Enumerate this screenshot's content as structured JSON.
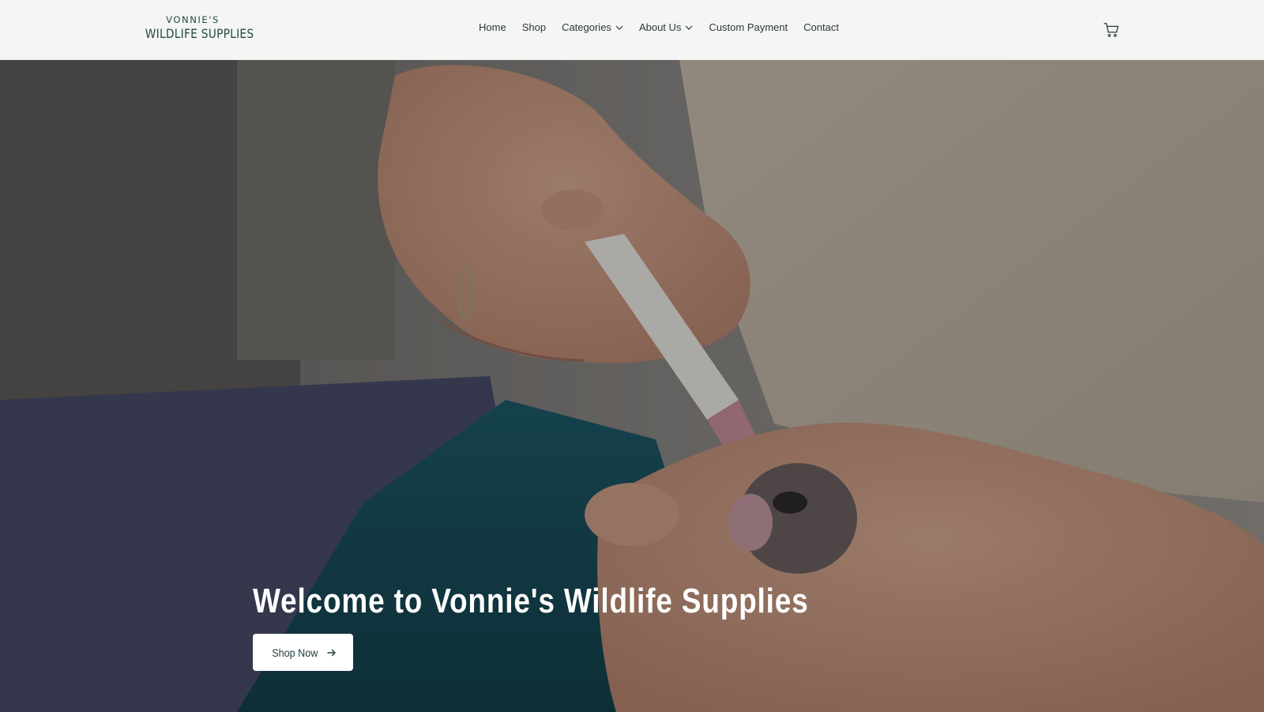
{
  "brand": {
    "line1": "VONNIE'S",
    "line2": "WILDLIFE SUPPLIES",
    "color": "#214848"
  },
  "nav": {
    "items": [
      {
        "label": "Home",
        "has_dropdown": false
      },
      {
        "label": "Shop",
        "has_dropdown": false
      },
      {
        "label": "Categories",
        "has_dropdown": true
      },
      {
        "label": "About Us",
        "has_dropdown": true
      },
      {
        "label": "Custom Payment",
        "has_dropdown": false
      },
      {
        "label": "Contact",
        "has_dropdown": false
      }
    ],
    "cart_icon": "cart-icon"
  },
  "hero": {
    "title": "Welcome to Vonnie's Wildlife Supplies",
    "button_label": "Shop Now",
    "button_icon": "arrow-right-icon"
  }
}
